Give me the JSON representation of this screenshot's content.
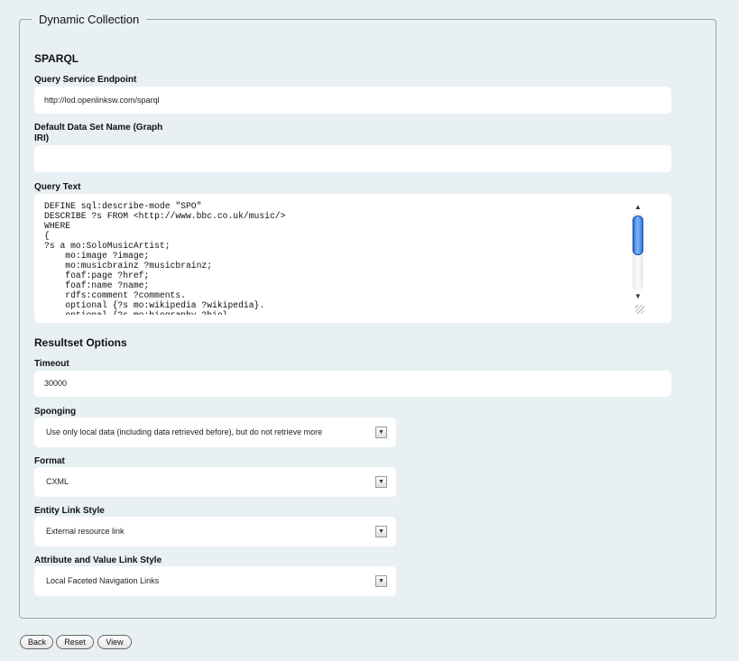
{
  "frame": {
    "legend": "Dynamic Collection"
  },
  "sparql": {
    "title": "SPARQL",
    "endpoint": {
      "label": "Query Service Endpoint",
      "value": "http://lod.openlinksw.com/sparql"
    },
    "default_graph": {
      "label_line1": "Default Data Set Name (Graph",
      "label_line2": "IRI)",
      "value": ""
    },
    "query": {
      "label": "Query Text",
      "text": "DEFINE sql:describe-mode \"SPO\"\nDESCRIBE ?s FROM <http://www.bbc.co.uk/music/>\nWHERE\n{\n?s a mo:SoloMusicArtist;\n    mo:image ?image;\n    mo:musicbrainz ?musicbrainz;\n    foaf:page ?href;\n    foaf:name ?name;\n    rdfs:comment ?comments.\n    optional {?s mo:wikipedia ?wikipedia}.\n    optional {?s mo:biography ?bio}."
    }
  },
  "resultset": {
    "title": "Resultset Options",
    "timeout": {
      "label": "Timeout",
      "value": "30000"
    },
    "sponging": {
      "label": "Sponging",
      "value": "Use only local data (including data retrieved before), but do not retrieve more"
    },
    "format": {
      "label": "Format",
      "value": "CXML"
    },
    "entity_link": {
      "label": "Entity Link Style",
      "value": "External resource link"
    },
    "attr_link": {
      "label": "Attribute and Value Link Style",
      "value": "Local Faceted Navigation Links"
    }
  },
  "buttons": {
    "back": "Back",
    "reset": "Reset",
    "view": "View"
  },
  "icons": {
    "dropdown": "chevron-down-icon",
    "scroll_up": "arrow-up-icon",
    "scroll_down": "arrow-down-icon"
  }
}
